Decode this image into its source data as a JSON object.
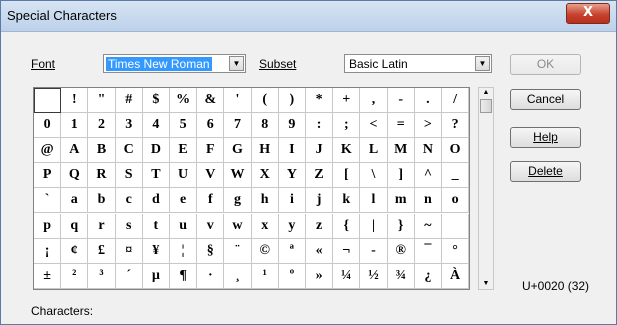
{
  "window": {
    "title": "Special Characters",
    "close_label": "X"
  },
  "font": {
    "label": "Font",
    "value": "Times New Roman"
  },
  "subset": {
    "label": "Subset",
    "value": "Basic Latin"
  },
  "buttons": {
    "ok": "OK",
    "cancel": "Cancel",
    "help": "Help",
    "delete": "Delete"
  },
  "characters_label": "Characters:",
  "code_readout": "U+0020 (32)",
  "grid": {
    "rows": [
      [
        "",
        "!",
        "\"",
        "#",
        "$",
        "%",
        "&",
        "'",
        "(",
        ")",
        "*",
        "+",
        ",",
        "-",
        ".",
        "/"
      ],
      [
        "0",
        "1",
        "2",
        "3",
        "4",
        "5",
        "6",
        "7",
        "8",
        "9",
        ":",
        ";",
        "<",
        "=",
        ">",
        "?"
      ],
      [
        "@",
        "A",
        "B",
        "C",
        "D",
        "E",
        "F",
        "G",
        "H",
        "I",
        "J",
        "K",
        "L",
        "M",
        "N",
        "O"
      ],
      [
        "P",
        "Q",
        "R",
        "S",
        "T",
        "U",
        "V",
        "W",
        "X",
        "Y",
        "Z",
        "[",
        "\\",
        "]",
        "^",
        "_"
      ],
      [
        "`",
        "a",
        "b",
        "c",
        "d",
        "e",
        "f",
        "g",
        "h",
        "i",
        "j",
        "k",
        "l",
        "m",
        "n",
        "o"
      ],
      [
        "p",
        "q",
        "r",
        "s",
        "t",
        "u",
        "v",
        "w",
        "x",
        "y",
        "z",
        "{",
        "|",
        "}",
        "~",
        ""
      ],
      [
        "¡",
        "¢",
        "£",
        "¤",
        "¥",
        "¦",
        "§",
        "¨",
        "©",
        "ª",
        "«",
        "¬",
        "-",
        "®",
        "¯",
        "°"
      ],
      [
        "±",
        "²",
        "³",
        "´",
        "µ",
        "¶",
        "·",
        "¸",
        "¹",
        "º",
        "»",
        "¼",
        "½",
        "¾",
        "¿",
        "À"
      ]
    ]
  }
}
